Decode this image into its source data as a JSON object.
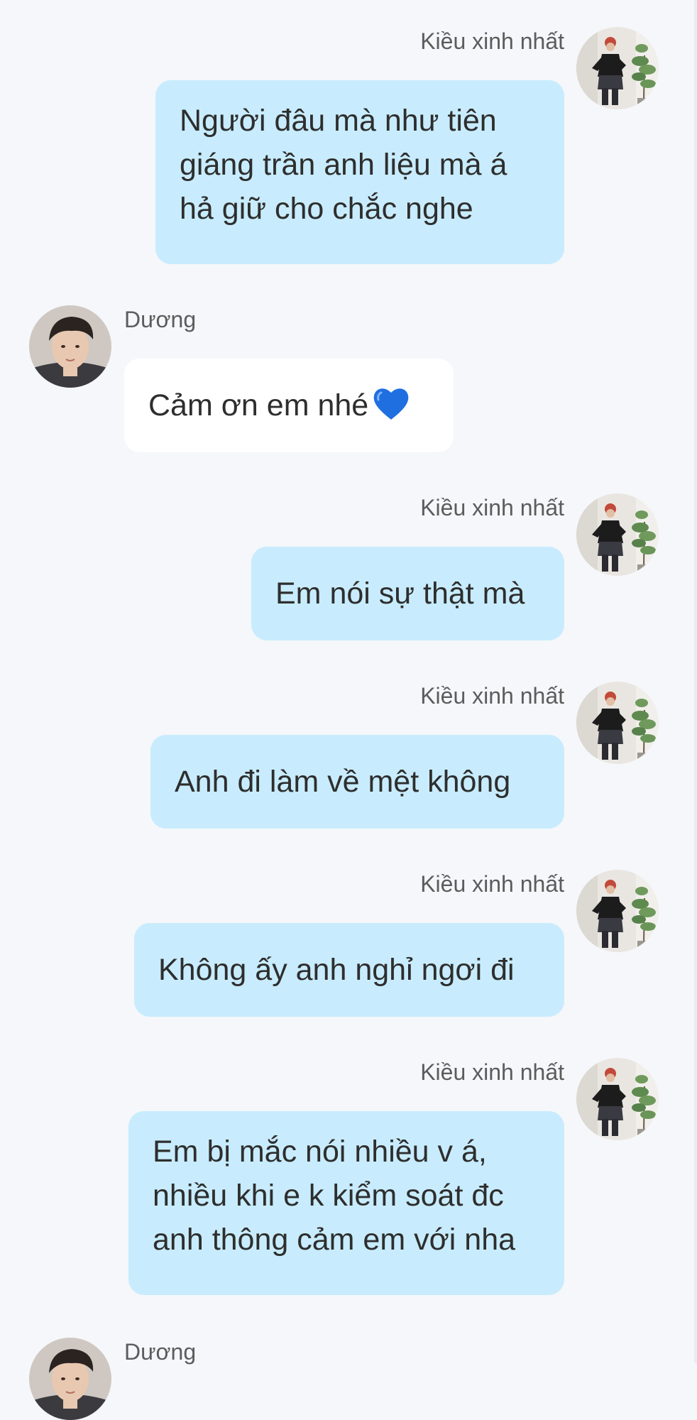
{
  "colors": {
    "background": "#f5f7fa",
    "outgoing_bubble": "#c8ecfd",
    "incoming_bubble": "#ffffff",
    "name_text": "#5c5c5c",
    "message_text": "#2e2e2e"
  },
  "messages": [
    {
      "direction": "out",
      "sender": "Kiều xinh nhất",
      "text": "Người đâu mà như tiên\ngiáng trần anh liệu mà á\nhả giữ cho chắc nghe"
    },
    {
      "direction": "in",
      "sender": "Dương",
      "text": "Cảm ơn em nhé",
      "emoji": "blue-heart-icon"
    },
    {
      "direction": "out",
      "sender": "Kiều xinh nhất",
      "text": "Em nói sự thật mà"
    },
    {
      "direction": "out",
      "sender": "Kiều xinh nhất",
      "text": "Anh đi làm về mệt không"
    },
    {
      "direction": "out",
      "sender": "Kiều xinh nhất",
      "text": "Không ấy anh nghỉ ngơi đi"
    },
    {
      "direction": "out",
      "sender": "Kiều xinh nhất",
      "text": "Em bị mắc nói nhiều v á,\nnhiều khi e k kiểm soát đc\nanh thông cảm em với nha"
    },
    {
      "direction": "in",
      "sender": "Dương",
      "text": ""
    }
  ]
}
